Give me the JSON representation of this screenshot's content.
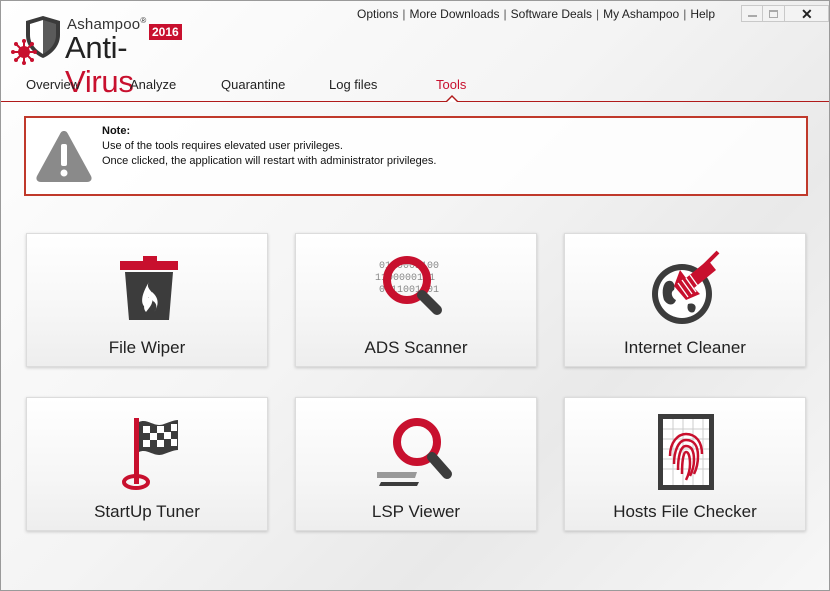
{
  "app": {
    "brand": "Ashampoo",
    "product_prefix": "Anti-",
    "product_suffix": "Virus",
    "year": "2016",
    "accent_color": "#c8102e"
  },
  "top_links": [
    "Options",
    "More Downloads",
    "Software Deals",
    "My Ashampoo",
    "Help"
  ],
  "window_controls": {
    "minimize": "minimize-icon",
    "maximize": "maximize-icon",
    "close": "close-icon"
  },
  "tabs": [
    {
      "label": "Overview",
      "active": false
    },
    {
      "label": "Analyze",
      "active": false
    },
    {
      "label": "Quarantine",
      "active": false
    },
    {
      "label": "Log files",
      "active": false
    },
    {
      "label": "Tools",
      "active": true
    }
  ],
  "note": {
    "title": "Note:",
    "line1": "Use of the tools requires elevated user privileges.",
    "line2": "Once clicked, the application will restart with administrator privileges.",
    "icon": "warning-icon"
  },
  "tools": [
    {
      "label": "File Wiper",
      "icon": "trash-fire-icon"
    },
    {
      "label": "ADS Scanner",
      "icon": "binary-magnifier-icon",
      "icon_text": [
        "0100001100",
        "1100000101",
        "0011001101"
      ]
    },
    {
      "label": "Internet Cleaner",
      "icon": "globe-broom-icon"
    },
    {
      "label": "StartUp Tuner",
      "icon": "flag-icon"
    },
    {
      "label": "LSP Viewer",
      "icon": "magnifier-icon"
    },
    {
      "label": "Hosts File Checker",
      "icon": "fingerprint-icon"
    }
  ]
}
